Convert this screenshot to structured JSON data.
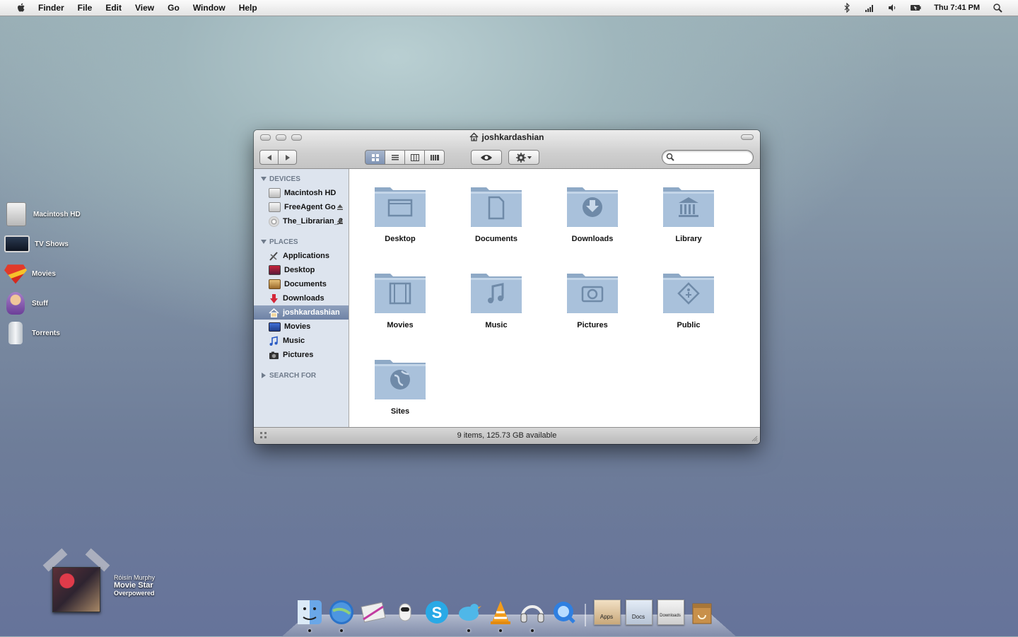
{
  "menubar": {
    "app": "Finder",
    "items": [
      "File",
      "Edit",
      "View",
      "Go",
      "Window",
      "Help"
    ],
    "clock": "Thu 7:41 PM",
    "status_icons": [
      "bluetooth-icon",
      "wifi-icon",
      "volume-icon",
      "battery-icon",
      "spotlight-icon"
    ]
  },
  "desktop_icons": [
    {
      "label": "Macintosh HD",
      "icon": "hard-drive-icon"
    },
    {
      "label": "TV Shows",
      "icon": "monitor-icon"
    },
    {
      "label": "Movies",
      "icon": "superman-icon"
    },
    {
      "label": "Stuff",
      "icon": "character-icon"
    },
    {
      "label": "Torrents",
      "icon": "jar-icon"
    }
  ],
  "window": {
    "title": "joshkardashian",
    "search_placeholder": "",
    "status": "9 items, 125.73 GB available"
  },
  "sidebar": {
    "devices_header": "DEVICES",
    "devices": [
      {
        "label": "Macintosh HD",
        "eject": false
      },
      {
        "label": "FreeAgent Go",
        "eject": true
      },
      {
        "label": "The_Librarian_2",
        "eject": true
      }
    ],
    "places_header": "PLACES",
    "places": [
      {
        "label": "Applications",
        "selected": false
      },
      {
        "label": "Desktop",
        "selected": false
      },
      {
        "label": "Documents",
        "selected": false
      },
      {
        "label": "Downloads",
        "selected": false
      },
      {
        "label": "joshkardashian",
        "selected": true
      },
      {
        "label": "Movies",
        "selected": false
      },
      {
        "label": "Music",
        "selected": false
      },
      {
        "label": "Pictures",
        "selected": false
      }
    ],
    "search_header": "SEARCH FOR"
  },
  "folders": [
    {
      "label": "Desktop",
      "glyph": "desktop-glyph"
    },
    {
      "label": "Documents",
      "glyph": "document-glyph"
    },
    {
      "label": "Downloads",
      "glyph": "download-glyph"
    },
    {
      "label": "Library",
      "glyph": "library-glyph"
    },
    {
      "label": "Movies",
      "glyph": "film-glyph"
    },
    {
      "label": "Music",
      "glyph": "music-glyph"
    },
    {
      "label": "Pictures",
      "glyph": "camera-glyph"
    },
    {
      "label": "Public",
      "glyph": "public-glyph"
    },
    {
      "label": "Sites",
      "glyph": "globe-glyph"
    }
  ],
  "now_playing": {
    "artist": "Róisín Murphy",
    "track": "Movie Star",
    "album": "Overpowered"
  },
  "dock": {
    "apps": [
      "finder-icon",
      "safari-icon",
      "mail-icon",
      "robot-icon",
      "skype-icon",
      "twitter-icon",
      "vlc-icon",
      "headphones-icon",
      "quicktime-icon"
    ],
    "stacks": [
      {
        "label": "Apps"
      },
      {
        "label": "Docs"
      },
      {
        "label": "Downloads"
      }
    ],
    "trash": "trash-icon"
  },
  "colors": {
    "selection": "#7f93b4",
    "sidebar_bg": "#dde4ee",
    "folder_blue": "#9db5cf"
  }
}
